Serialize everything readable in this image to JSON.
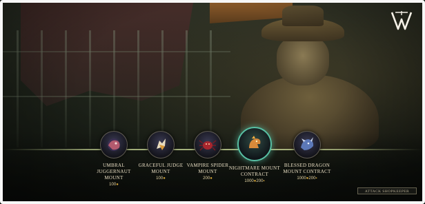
{
  "shop": {
    "items": [
      {
        "name": "Umbral Juggernaut Mount",
        "price": "100",
        "price_extra": "",
        "icon": "juggernaut-mount-icon",
        "selected": false
      },
      {
        "name": "Graceful Judge Mount",
        "price": "100",
        "price_extra": "",
        "icon": "judge-mount-icon",
        "selected": false
      },
      {
        "name": "Vampire Spider Mount",
        "price": "200",
        "price_extra": "",
        "icon": "spider-mount-icon",
        "selected": false
      },
      {
        "name": "Nightmare Mount Contract",
        "price": "1000",
        "price_extra": "200",
        "icon": "nightmare-mount-icon",
        "selected": true
      },
      {
        "name": "Blessed Dragon Mount Contract",
        "price": "1000",
        "price_extra": "200",
        "icon": "dragon-mount-icon",
        "selected": false
      }
    ],
    "attack_button_label": "Attack Shopkeeper"
  },
  "colors": {
    "accent": "#58c0a4",
    "coin": "#d4a437",
    "text": "#eadfc4"
  }
}
